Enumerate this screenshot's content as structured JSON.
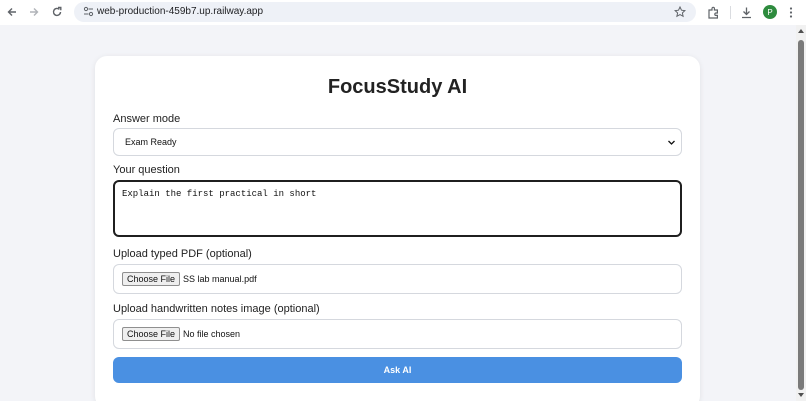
{
  "browser": {
    "url": "web-production-459b7.up.railway.app",
    "profile_initial": "P",
    "icons": [
      "back-icon",
      "forward-icon",
      "reload-icon",
      "site-info-icon",
      "bookmark-star-icon",
      "extensions-icon",
      "download-icon",
      "menu-dots-icon"
    ]
  },
  "page": {
    "title": "FocusStudy AI",
    "answer_mode": {
      "label": "Answer mode",
      "selected": "Exam Ready"
    },
    "question": {
      "label": "Your question",
      "value": "Explain the first practical in short"
    },
    "pdf_upload": {
      "label": "Upload typed PDF (optional)",
      "button": "Choose File",
      "file_name": "SS lab manual.pdf"
    },
    "image_upload": {
      "label": "Upload handwritten notes image (optional)",
      "button": "Choose File",
      "file_name": "No file chosen"
    },
    "submit_label": "Ask AI"
  },
  "colors": {
    "accent": "#4a90e2",
    "background": "#f3f4f8",
    "card": "#ffffff",
    "avatar": "#2e8b3e"
  }
}
